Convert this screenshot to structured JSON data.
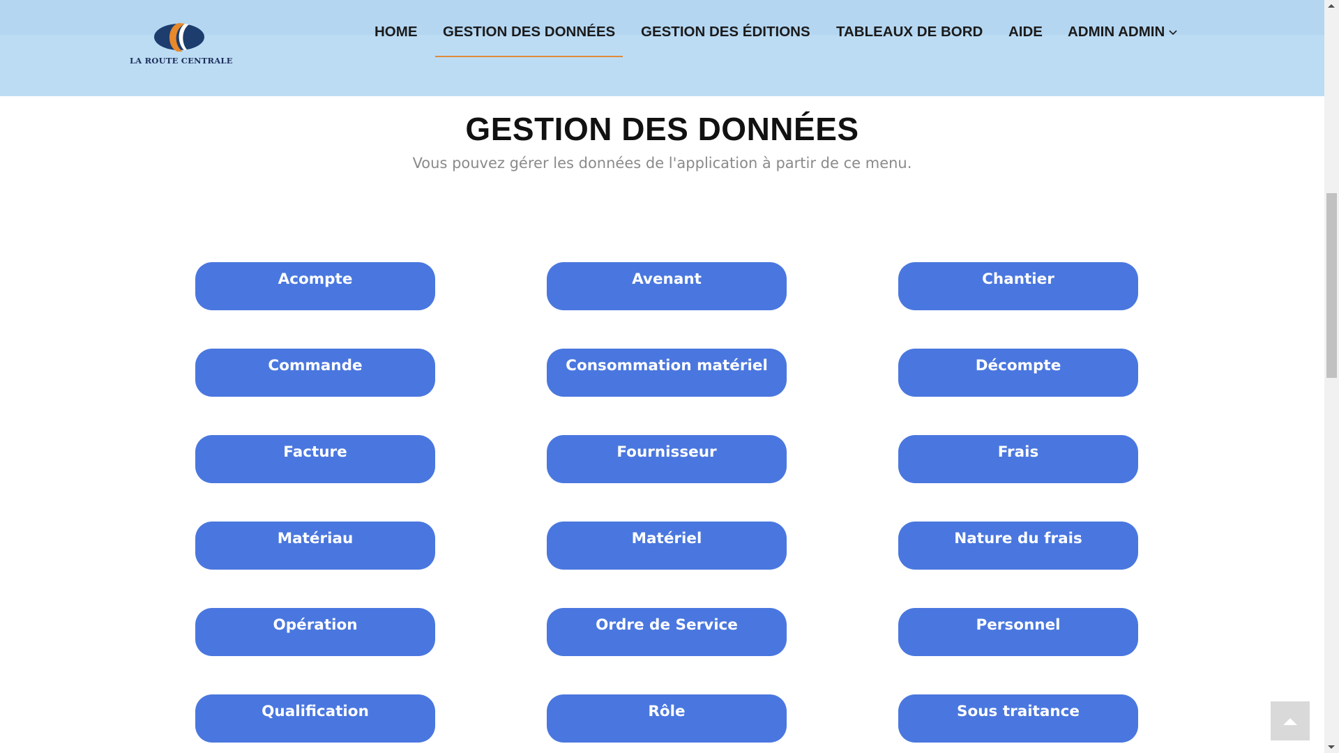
{
  "brand": {
    "name": "LA ROUTE CENTRALE",
    "colors": {
      "navy": "#1c3d6e",
      "orange": "#e8892a"
    }
  },
  "nav": {
    "items": [
      {
        "label": "HOME"
      },
      {
        "label": "GESTION DES DONNÉES",
        "active": true
      },
      {
        "label": "GESTION DES ÉDITIONS"
      },
      {
        "label": "TABLEAUX DE BORD"
      },
      {
        "label": "AIDE"
      },
      {
        "label": "ADMIN ADMIN",
        "dropdown": true,
        "icon": "chevron-down-icon"
      }
    ],
    "accent_color": "#e08a3a"
  },
  "page": {
    "title": "GESTION DES DONNÉES",
    "subtitle": "Vous pouvez gérer les données de l'application à partir de ce menu."
  },
  "buttons": [
    {
      "label": "Acompte"
    },
    {
      "label": "Avenant"
    },
    {
      "label": "Chantier"
    },
    {
      "label": "Commande"
    },
    {
      "label": "Consommation matériel"
    },
    {
      "label": "Décompte"
    },
    {
      "label": "Facture"
    },
    {
      "label": "Fournisseur"
    },
    {
      "label": "Frais"
    },
    {
      "label": "Matériau"
    },
    {
      "label": "Matériel"
    },
    {
      "label": "Nature du frais"
    },
    {
      "label": "Opération"
    },
    {
      "label": "Ordre de Service"
    },
    {
      "label": "Personnel"
    },
    {
      "label": "Qualification"
    },
    {
      "label": "Rôle"
    },
    {
      "label": "Sous traitance"
    }
  ],
  "button_color": "#4a77df",
  "back_to_top": {
    "icon": "chevron-up-icon"
  }
}
